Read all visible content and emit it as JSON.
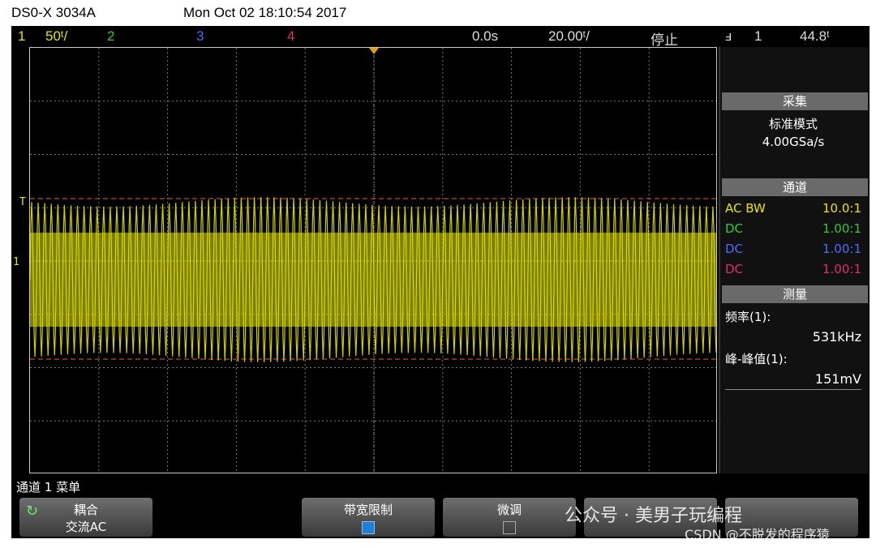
{
  "header": {
    "model": "DS0-X 3034A",
    "datetime": "Mon Oct 02 18:10:54 2017"
  },
  "status": {
    "ch1_num": "1",
    "ch1_scale": "50ᵗ/",
    "ch2": "2",
    "ch3": "3",
    "ch4": "4",
    "time_delay": "0.0s",
    "time_scale": "20.00ᵗ/",
    "run_state": "停止",
    "trigger_icon": "ⅎ",
    "trigger_source": "1",
    "trigger_level": "44.8ᵗ"
  },
  "markers": {
    "trigger_level": "T",
    "ch1_ground": "1"
  },
  "side": {
    "acquire": {
      "title": "采集",
      "mode": "标准模式",
      "rate": "4.00GSa/s"
    },
    "channels": {
      "title": "通道",
      "rows": [
        {
          "coupling": "AC BW",
          "value": "10.0:1",
          "color": "#e6e600"
        },
        {
          "coupling": "DC",
          "value": "1.00:1",
          "color": "#33cc33"
        },
        {
          "coupling": "DC",
          "value": "1.00:1",
          "color": "#4d6cff"
        },
        {
          "coupling": "DC",
          "value": "1.00:1",
          "color": "#e0306a"
        }
      ]
    },
    "measure": {
      "title": "测量",
      "freq_label": "频率(1):",
      "freq_value": "531kHz",
      "vpp_label": "峰-峰值(1):",
      "vpp_value": "151mV"
    }
  },
  "menu": {
    "title": "通道 1 菜单",
    "coupling_label": "耦合",
    "coupling_value": "交流AC",
    "bw_limit_label": "带宽限制",
    "fine_label": "微调"
  },
  "watermarks": {
    "wechat": "公众号 · 美男子玩编程",
    "csdn": "CSDN @不脱发的程序猿"
  },
  "colors": {
    "ch1": "#e6e600",
    "grid": "#7a7a7a",
    "trigger_line": "#e0603a",
    "side_bg": "#111111"
  }
}
